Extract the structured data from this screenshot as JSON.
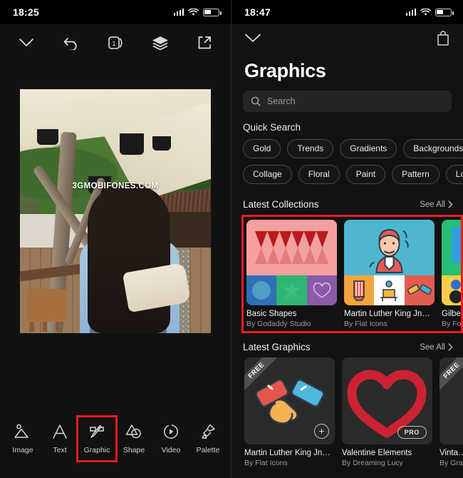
{
  "left_panel": {
    "status": {
      "time": "18:25",
      "signal": "signal-icon",
      "wifi": "wifi-icon",
      "battery": "battery-icon"
    },
    "toolbar_top": [
      {
        "name": "collapse-chevron",
        "icon": "chevron-down-icon"
      },
      {
        "name": "undo",
        "icon": "undo-arrow-icon"
      },
      {
        "name": "page-count",
        "icon": "page-1-icon",
        "label": "1"
      },
      {
        "name": "layers",
        "icon": "layers-icon"
      },
      {
        "name": "share",
        "icon": "share-export-icon"
      }
    ],
    "canvas": {
      "watermark": "3GMOBIFONES.COM"
    },
    "bottom_tools": [
      {
        "label": "Image",
        "icon": "image-icon",
        "selected": false
      },
      {
        "label": "Text",
        "icon": "text-a-icon",
        "selected": false
      },
      {
        "label": "Graphic",
        "icon": "graphic-pen-icon",
        "selected": true
      },
      {
        "label": "Shape",
        "icon": "shape-icon",
        "selected": false
      },
      {
        "label": "Video",
        "icon": "video-play-icon",
        "selected": false
      },
      {
        "label": "Palette",
        "icon": "palette-brush-icon",
        "selected": false
      }
    ]
  },
  "right_panel": {
    "status": {
      "time": "18:47",
      "signal": "signal-icon",
      "wifi": "wifi-icon",
      "battery": "battery-icon"
    },
    "nav": {
      "collapse_icon": "chevron-down-icon",
      "bag_icon": "shopping-bag-icon"
    },
    "title": "Graphics",
    "search": {
      "placeholder": "Search",
      "icon": "search-icon",
      "value": ""
    },
    "quick_search": {
      "heading": "Quick Search",
      "row1": [
        "Gold",
        "Trends",
        "Gradients",
        "Backgrounds"
      ],
      "row2": [
        "Collage",
        "Floral",
        "Paint",
        "Pattern",
        "Logo"
      ]
    },
    "latest_collections": {
      "heading": "Latest Collections",
      "see_all": "See All",
      "see_all_icon": "chevron-right-icon",
      "highlighted": true,
      "items": [
        {
          "name": "Basic Shapes",
          "by": "By Godaddy Studio"
        },
        {
          "name": "Martin Luther King Jn…",
          "by": "By Flat Icons"
        },
        {
          "name": "Gilbe…",
          "by": "By For…"
        }
      ]
    },
    "latest_graphics": {
      "heading": "Latest Graphics",
      "see_all": "See All",
      "see_all_icon": "chevron-right-icon",
      "items": [
        {
          "name": "Martin Luther King Jn…",
          "by": "By Flat Icons",
          "badge": "FREE",
          "action": "+"
        },
        {
          "name": "Valentine Elements",
          "by": "By Dreaming Lucy",
          "badge": "",
          "action": "PRO"
        },
        {
          "name": "Vinta…",
          "by": "By Gra…",
          "badge": "FREE",
          "action": ""
        }
      ]
    }
  },
  "colors": {
    "accent_red": "#ed1c24",
    "bg": "#121212",
    "panel": "#111111",
    "chip_border": "#4a4a4a"
  }
}
